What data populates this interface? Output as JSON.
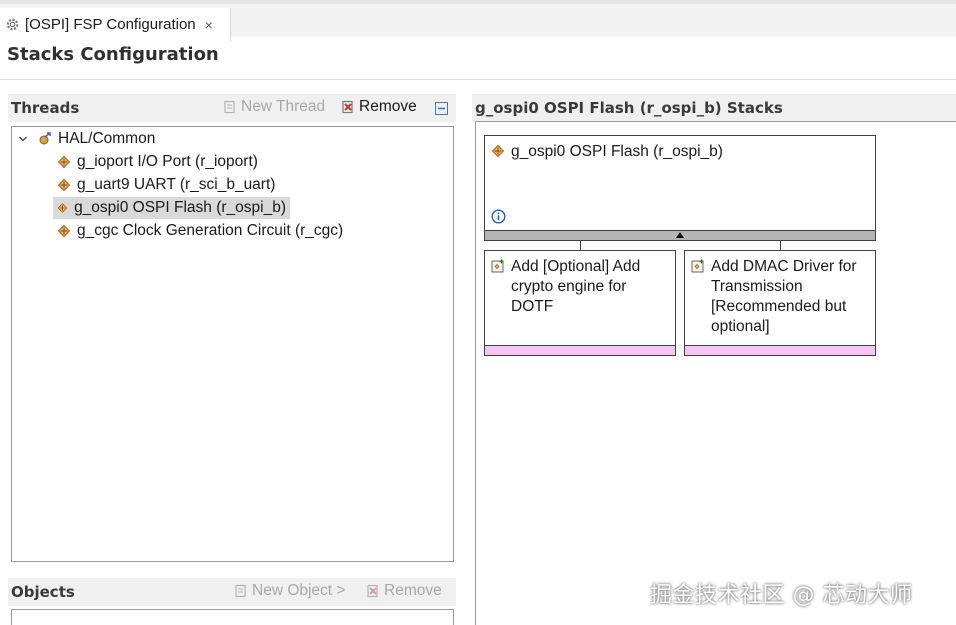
{
  "editor_tab": {
    "title": "[OSPI] FSP Configuration",
    "close": "×"
  },
  "page_title": "Stacks Configuration",
  "threads": {
    "heading": "Threads",
    "new_thread": "New Thread",
    "remove": "Remove",
    "tree": {
      "root": "HAL/Common",
      "items": [
        "g_ioport I/O Port (r_ioport)",
        "g_uart9 UART (r_sci_b_uart)",
        "g_ospi0 OSPI Flash (r_ospi_b)",
        "g_cgc Clock Generation Circuit (r_cgc)"
      ],
      "selected_index": 2
    }
  },
  "objects": {
    "heading": "Objects",
    "new_object": "New Object >",
    "remove": "Remove"
  },
  "stacks": {
    "heading": "g_ospi0 OSPI Flash (r_ospi_b) Stacks",
    "main_module": "g_ospi0 OSPI Flash (r_ospi_b)",
    "child_modules": [
      {
        "lines": [
          "Add [Optional] Add",
          "crypto engine for",
          "DOTF"
        ]
      },
      {
        "lines": [
          "Add DMAC Driver for",
          "Transmission",
          "[Recommended but",
          "optional]"
        ]
      }
    ]
  },
  "watermark": "掘金技术社区 @ 芯动大师",
  "colors": {
    "component_icon": "#c07a2a",
    "remove_icon": "#c0392b",
    "pink_bar": "#f8c6f4",
    "module_bar": "#b4b4b4",
    "info_icon": "#1f5fa8"
  }
}
